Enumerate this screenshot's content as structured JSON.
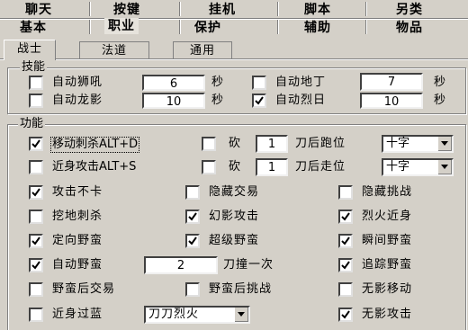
{
  "top_tabs_row1": [
    "聊天",
    "按键",
    "挂机",
    "脚本",
    "另类"
  ],
  "top_tabs_row2": [
    "基本",
    "职业",
    "保护",
    "辅助",
    "物品"
  ],
  "sub_tabs": [
    "战士",
    "法道",
    "通用"
  ],
  "skills_group": {
    "legend": "技能",
    "items": [
      {
        "label": "自动狮吼",
        "checked": false,
        "value": "6",
        "unit": "秒"
      },
      {
        "label": "自动地丁",
        "checked": false,
        "value": "7",
        "unit": "秒"
      },
      {
        "label": "自动龙影",
        "checked": false,
        "value": "10",
        "unit": "秒"
      },
      {
        "label": "自动烈日",
        "checked": true,
        "value": "10",
        "unit": "秒"
      }
    ]
  },
  "function_group": {
    "legend": "功能",
    "move_stab": {
      "label": "移动刺杀ALT+D",
      "checked": true
    },
    "chop1": {
      "label": "砍",
      "checked": false,
      "value": "1",
      "suffix": "刀后跑位",
      "select": "十字"
    },
    "close_attack": {
      "label": "近身攻击ALT+S",
      "checked": false
    },
    "chop2": {
      "label": "砍",
      "checked": false,
      "value": "1",
      "suffix": "刀后走位",
      "select": "十字"
    },
    "grid": [
      [
        {
          "label": "攻击不卡",
          "checked": true
        },
        {
          "label": "隐藏交易",
          "checked": false
        },
        {
          "label": "隐藏挑战",
          "checked": false
        }
      ],
      [
        {
          "label": "挖地刺杀",
          "checked": false
        },
        {
          "label": "幻影攻击",
          "checked": true
        },
        {
          "label": "烈火近身",
          "checked": true
        }
      ],
      [
        {
          "label": "定向野蛮",
          "checked": true
        },
        {
          "label": "超级野蛮",
          "checked": true
        },
        {
          "label": "瞬间野蛮",
          "checked": true
        }
      ]
    ],
    "auto_barbarian": {
      "label": "自动野蛮",
      "checked": true,
      "value": "2",
      "suffix": "刀撞一次"
    },
    "track_barbarian": {
      "label": "追踪野蛮",
      "checked": true
    },
    "row_after": [
      {
        "label": "野蛮后交易",
        "checked": false
      },
      {
        "label": "野蛮后挑战",
        "checked": false
      },
      {
        "label": "无影移动",
        "checked": false
      }
    ],
    "close_cross": {
      "label": "近身过蓝",
      "checked": false,
      "select": "刀刀烈火"
    },
    "shadowless_attack": {
      "label": "无影攻击",
      "checked": true
    }
  }
}
